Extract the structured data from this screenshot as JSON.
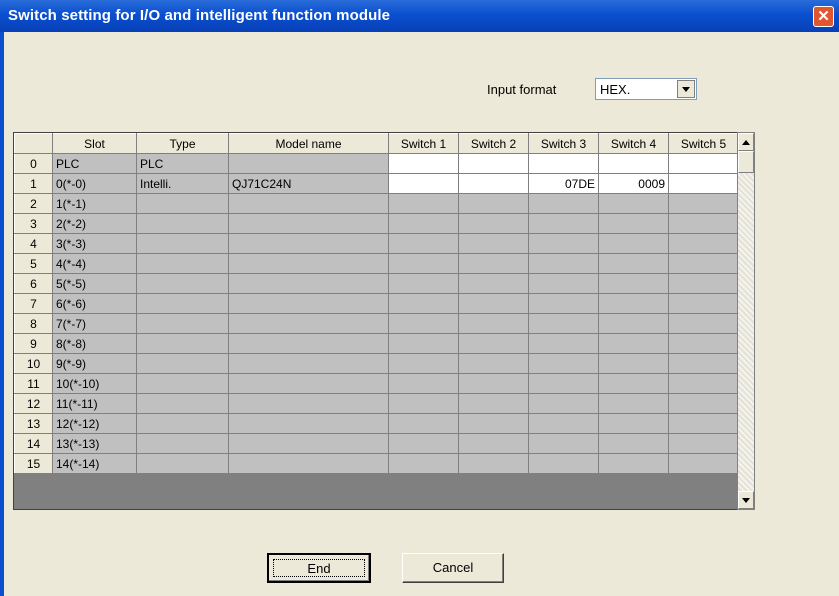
{
  "window": {
    "title": "Switch setting for I/O and intelligent function module",
    "close_glyph": "✕"
  },
  "input_format": {
    "label": "Input format",
    "value": "HEX."
  },
  "table": {
    "columns": [
      "",
      "Slot",
      "Type",
      "Model name",
      "Switch 1",
      "Switch 2",
      "Switch 3",
      "Switch 4",
      "Switch 5"
    ],
    "rows": [
      [
        "0",
        "PLC",
        "PLC",
        "",
        "",
        "",
        "",
        "",
        ""
      ],
      [
        "1",
        "0(*-0)",
        "Intelli.",
        "QJ71C24N",
        "",
        "",
        "07DE",
        "0009",
        ""
      ],
      [
        "2",
        "1(*-1)",
        "",
        "",
        "",
        "",
        "",
        "",
        ""
      ],
      [
        "3",
        "2(*-2)",
        "",
        "",
        "",
        "",
        "",
        "",
        ""
      ],
      [
        "4",
        "3(*-3)",
        "",
        "",
        "",
        "",
        "",
        "",
        ""
      ],
      [
        "5",
        "4(*-4)",
        "",
        "",
        "",
        "",
        "",
        "",
        ""
      ],
      [
        "6",
        "5(*-5)",
        "",
        "",
        "",
        "",
        "",
        "",
        ""
      ],
      [
        "7",
        "6(*-6)",
        "",
        "",
        "",
        "",
        "",
        "",
        ""
      ],
      [
        "8",
        "7(*-7)",
        "",
        "",
        "",
        "",
        "",
        "",
        ""
      ],
      [
        "9",
        "8(*-8)",
        "",
        "",
        "",
        "",
        "",
        "",
        ""
      ],
      [
        "10",
        "9(*-9)",
        "",
        "",
        "",
        "",
        "",
        "",
        ""
      ],
      [
        "11",
        "10(*-10)",
        "",
        "",
        "",
        "",
        "",
        "",
        ""
      ],
      [
        "12",
        "11(*-11)",
        "",
        "",
        "",
        "",
        "",
        "",
        ""
      ],
      [
        "13",
        "12(*-12)",
        "",
        "",
        "",
        "",
        "",
        "",
        ""
      ],
      [
        "14",
        "13(*-13)",
        "",
        "",
        "",
        "",
        "",
        "",
        ""
      ],
      [
        "15",
        "14(*-14)",
        "",
        "",
        "",
        "",
        "",
        "",
        ""
      ]
    ]
  },
  "buttons": {
    "end": "End",
    "cancel": "Cancel"
  }
}
